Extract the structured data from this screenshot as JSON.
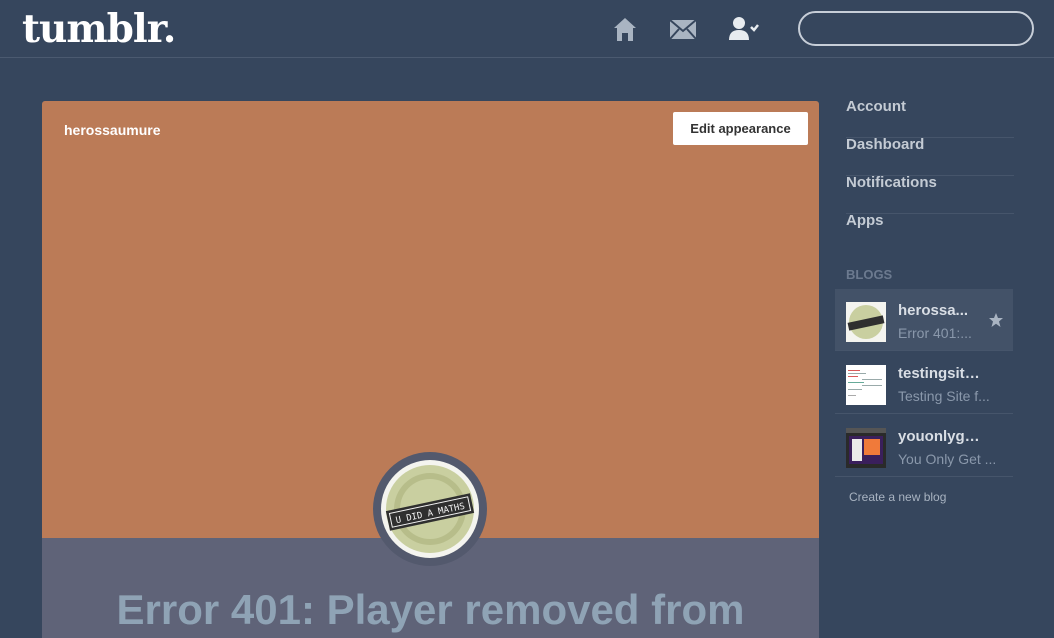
{
  "app": {
    "logo": "tumblr."
  },
  "header": {
    "nav": [
      {
        "icon": "home-icon"
      },
      {
        "icon": "mail-icon"
      },
      {
        "icon": "account-icon"
      }
    ],
    "search": {
      "value": "",
      "placeholder": ""
    }
  },
  "blog_panel": {
    "blog_name": "herossaumure",
    "edit_label": "Edit appearance",
    "header_color": "#bb7b57",
    "avatar_text": "U DID A MATHS",
    "post_title": "Error 401: Player removed from"
  },
  "sidebar": {
    "links": [
      {
        "label": "Account"
      },
      {
        "label": "Dashboard"
      },
      {
        "label": "Notifications"
      },
      {
        "label": "Apps"
      }
    ],
    "blogs_heading": "BLOGS",
    "blogs": [
      {
        "title": "herossa...",
        "subtitle": "Error 401:...",
        "active": true
      },
      {
        "title": "testingsitef...",
        "subtitle": "Testing Site f...",
        "active": false
      },
      {
        "title": "youonlyget...",
        "subtitle": "You Only Get ...",
        "active": false
      }
    ],
    "create_label": "Create a new blog"
  },
  "colors": {
    "background": "#36465d",
    "header_image": "#bb7b57",
    "panel_lower": "#5f6378",
    "title_text": "#8fa3b5"
  }
}
